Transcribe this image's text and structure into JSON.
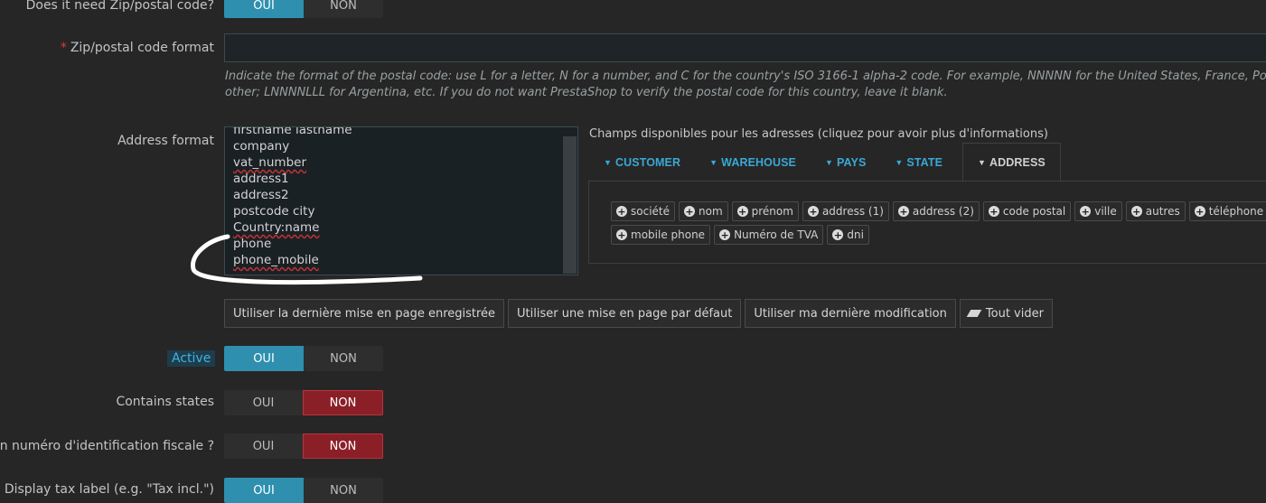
{
  "zip_required": {
    "label": "Does it need Zip/postal code?",
    "yes": "OUI",
    "no": "NON",
    "selected": "OUI"
  },
  "zip_format": {
    "label": "Zip/postal code format",
    "required_mark": "*",
    "value": "",
    "help_line1": "Indicate the format of the postal code: use L for a letter, N for a number, and C for the country's ISO 3166-1 alpha-2 code. For example, NNNNN for the United States, France, Poland and ma",
    "help_line2": "other; LNNNNLLL for Argentina, etc. If you do not want PrestaShop to verify the postal code for this country, leave it blank."
  },
  "address_format": {
    "label": "Address format",
    "lines": [
      "firstname lastname",
      "company",
      "vat_number",
      "address1",
      "address2",
      "postcode city",
      "Country:name",
      "phone",
      "phone_mobile"
    ]
  },
  "fields_panel": {
    "title": "Champs disponibles pour les adresses (cliquez pour avoir plus d'informations)",
    "tabs": [
      "CUSTOMER",
      "WAREHOUSE",
      "PAYS",
      "STATE",
      "ADDRESS"
    ],
    "active_tab": "ADDRESS",
    "chips": [
      "société",
      "nom",
      "prénom",
      "address (1)",
      "address (2)",
      "code postal",
      "ville",
      "autres",
      "téléphone",
      "mobile phone",
      "Numéro de TVA",
      "dni"
    ]
  },
  "layout_buttons": {
    "last_saved": "Utiliser la dernière mise en page enregistrée",
    "default": "Utiliser une mise en page par défaut",
    "last_modification": "Utiliser ma dernière modification",
    "clear_all": "Tout vider"
  },
  "active": {
    "label": "Active",
    "yes": "OUI",
    "no": "NON",
    "selected": "OUI"
  },
  "contains_states": {
    "label": "Contains states",
    "yes": "OUI",
    "no": "NON",
    "selected": "NON"
  },
  "tax_id": {
    "label": "un numéro d'identification fiscale ?",
    "yes": "OUI",
    "no": "NON",
    "selected": "NON"
  },
  "tax_label": {
    "label": "Display tax label (e.g. \"Tax incl.\")",
    "yes": "OUI",
    "no": "NON",
    "selected": "OUI"
  },
  "colors": {
    "accent_blue": "#2f8fae",
    "no_red": "#8b1f27",
    "tab_blue": "#3aa8d6",
    "background": "#262626"
  }
}
